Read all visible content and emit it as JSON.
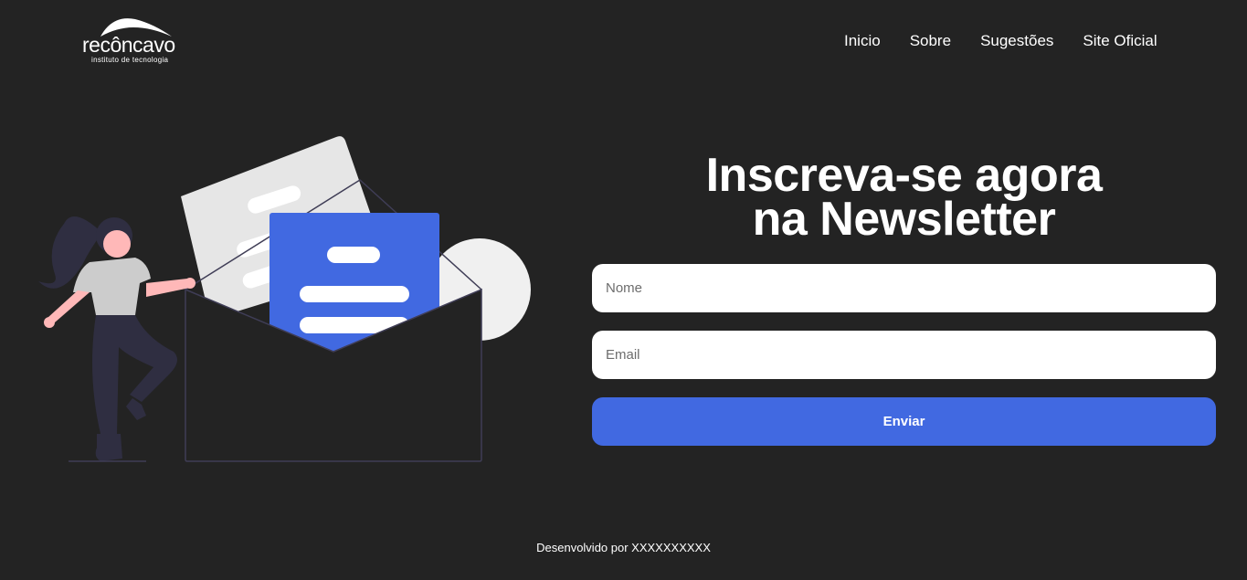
{
  "brand": {
    "name": "recôncavo",
    "subtitle": "instituto de tecnologia"
  },
  "nav": {
    "items": [
      {
        "label": "Inicio"
      },
      {
        "label": "Sobre"
      },
      {
        "label": "Sugestões"
      },
      {
        "label": "Site Oficial"
      }
    ]
  },
  "hero": {
    "title_line1": "Inscreva-se agora",
    "title_line2": "na Newsletter"
  },
  "form": {
    "name_placeholder": "Nome",
    "email_placeholder": "Email",
    "submit_label": "Enviar"
  },
  "footer": {
    "text": "Desenvolvido por XXXXXXXXXX"
  },
  "colors": {
    "background": "#232323",
    "accent": "#4169e1",
    "text": "#ffffff",
    "input_bg": "#ffffff"
  },
  "icons": {
    "logo_arc": "logo-arc-icon",
    "illustration": "newsletter-illustration"
  }
}
